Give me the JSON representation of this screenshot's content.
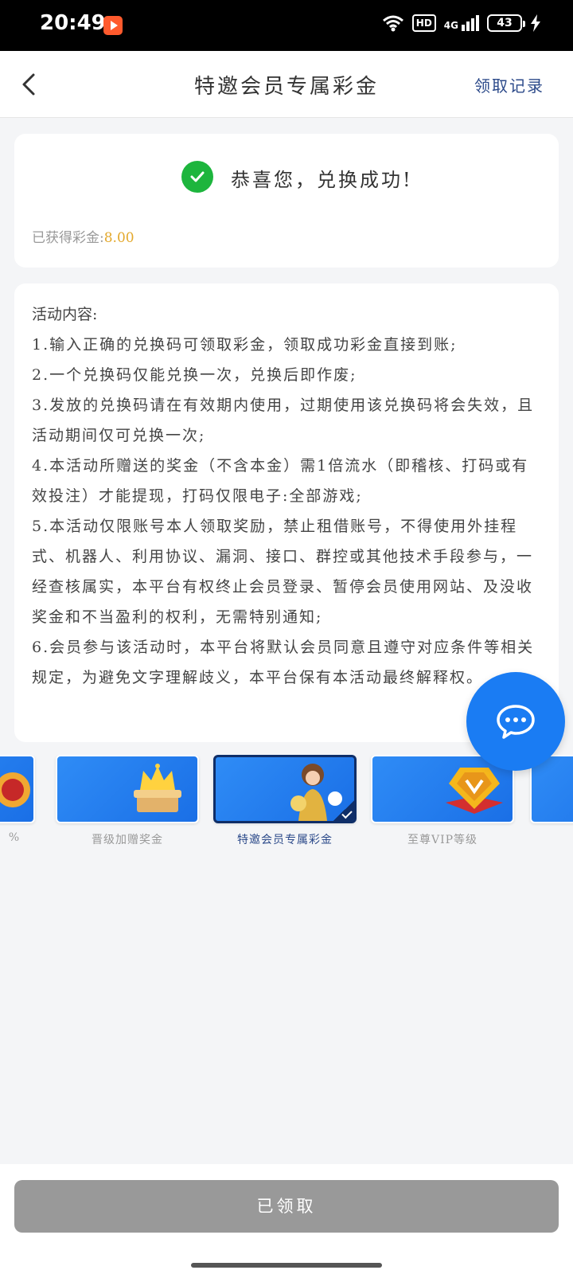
{
  "status_bar": {
    "time": "20:49",
    "hd": "HD",
    "network": "4G",
    "battery": "43"
  },
  "header": {
    "title": "特邀会员专属彩金",
    "records_link": "领取记录"
  },
  "success": {
    "message": "恭喜您，兑换成功!",
    "reward_label": "已获得彩金:",
    "reward_value": "8.00"
  },
  "rules": {
    "heading": "活动内容:",
    "items": [
      "1.输入正确的兑换码可领取彩金，领取成功彩金直接到账;",
      "2.一个兑换码仅能兑换一次，兑换后即作废;",
      "3.发放的兑换码请在有效期内使用，过期使用该兑换码将会失效，且活动期间仅可兑换一次;",
      "4.本活动所赠送的奖金（不含本金）需1倍流水（即稽核、打码或有效投注）才能提现，打码仅限电子:全部游戏;",
      "5.本活动仅限账号本人领取奖励，禁止租借账号，不得使用外挂程式、机器人、利用协议、漏洞、接口、群控或其他技术手段参与，一经查核属实，本平台有权终止会员登录、暂停会员使用网站、及没收奖金和不当盈利的权利，无需特别通知;",
      "6.会员参与该活动时，本平台将默认会员同意且遵守对应条件等相关规定，为避免文字理解歧义，本平台保有本活动最终解释权。"
    ]
  },
  "carousel": {
    "items": [
      {
        "label": "%"
      },
      {
        "label": "晋级加赠奖金"
      },
      {
        "label": "特邀会员专属彩金",
        "selected": true
      },
      {
        "label": "至尊VIP等级"
      }
    ]
  },
  "bottom": {
    "button_label": "已领取"
  },
  "colors": {
    "accent_blue": "#1a7cf3",
    "success_green": "#1db53d",
    "reward_gold": "#e3a82b",
    "disabled_gray": "#999999"
  }
}
